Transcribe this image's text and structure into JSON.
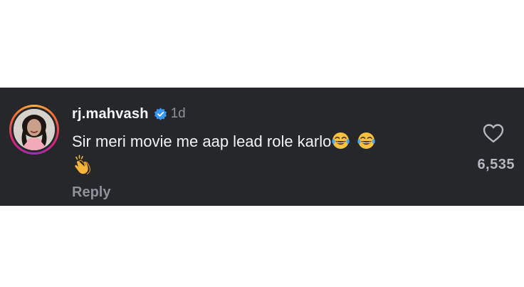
{
  "comment": {
    "username": "rj.mahvash",
    "verified_icon": "verified-badge-icon",
    "time_ago": "1d",
    "text": "Sir meri movie me aap lead role karlo",
    "trailing_emojis": [
      "face-with-tears-of-joy",
      "face-with-tears-of-joy"
    ],
    "second_line_emoji": "clapping-hands",
    "reply_label": "Reply",
    "like_icon": "heart-outline-icon",
    "like_count": "6,535"
  },
  "colors": {
    "card_background": "#25272b",
    "page_background": "#ffffff",
    "text_primary": "#f2f3f5",
    "text_secondary": "#8d9199",
    "verified_blue": "#3897f0"
  }
}
